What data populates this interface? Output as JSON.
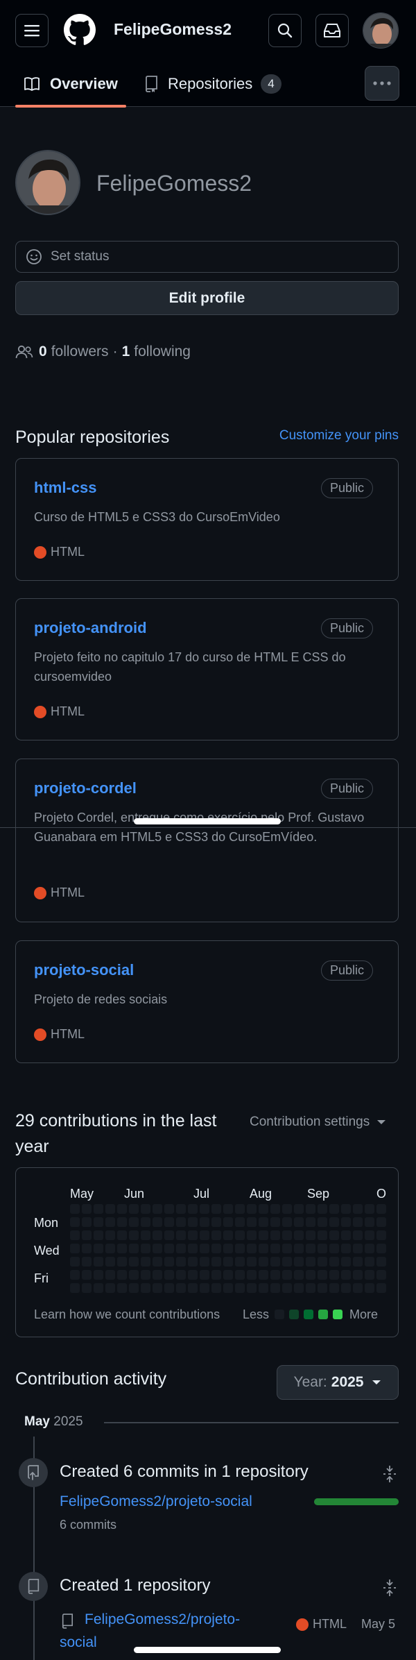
{
  "header": {
    "username": "FelipeGomess2",
    "menu_icon": "hamburger-icon",
    "logo_icon": "github-logo-icon",
    "search_icon": "search-icon",
    "inbox_icon": "inbox-icon"
  },
  "tabs": [
    {
      "label": "Overview",
      "icon": "book-icon",
      "selected": true
    },
    {
      "label": "Repositories",
      "icon": "repo-icon",
      "count": "4"
    }
  ],
  "profile": {
    "display_name": "FelipeGomess2",
    "set_status": "Set status",
    "edit_profile": "Edit profile",
    "followers_count": "0",
    "followers_label": "followers",
    "separator": "·",
    "following_count": "1",
    "following_label": "following"
  },
  "popular": {
    "title": "Popular repositories",
    "customize": "Customize your pins",
    "repos": [
      {
        "name": "html-css",
        "visibility": "Public",
        "description": "Curso de HTML5 e CSS3 do CursoEmVideo",
        "language": "HTML"
      },
      {
        "name": "projeto-android",
        "visibility": "Public",
        "description": "Projeto feito no capitulo 17 do curso de HTML E CSS do cursoemvideo",
        "language": "HTML"
      },
      {
        "name": "projeto-cordel",
        "visibility": "Public",
        "description": "Projeto Cordel, entregue como exercício pelo Prof. Gustavo Guanabara em HTML5 e CSS3 do CursoEmVídeo.",
        "language": "HTML"
      },
      {
        "name": "projeto-social",
        "visibility": "Public",
        "description": "Projeto de redes sociais",
        "language": "HTML"
      }
    ]
  },
  "contributions": {
    "title": "29 contributions in the last year",
    "settings": "Contribution settings",
    "months": [
      "May",
      "Jun",
      "Jul",
      "Aug",
      "Sep",
      "O"
    ],
    "days": [
      "Mon",
      "Wed",
      "Fri"
    ],
    "learn": "Learn how we count contributions",
    "less": "Less",
    "more": "More",
    "legend_colors": [
      "#161b22",
      "#0e4429",
      "#006d32",
      "#26a641",
      "#39d353"
    ]
  },
  "activity": {
    "title": "Contribution activity",
    "year_prefix": "Year:",
    "year": "2025",
    "month": "May",
    "month_year": "2025",
    "items": [
      {
        "title": "Created 6 commits in 1 repository",
        "repo": "FelipeGomess2/projeto-social",
        "sub": "6 commits",
        "progress": 1.0
      },
      {
        "title": "Created 1 repository",
        "repo_line1": "FelipeGomess2/projeto-",
        "repo_line2": "social",
        "language": "HTML",
        "date": "May 5"
      }
    ]
  }
}
